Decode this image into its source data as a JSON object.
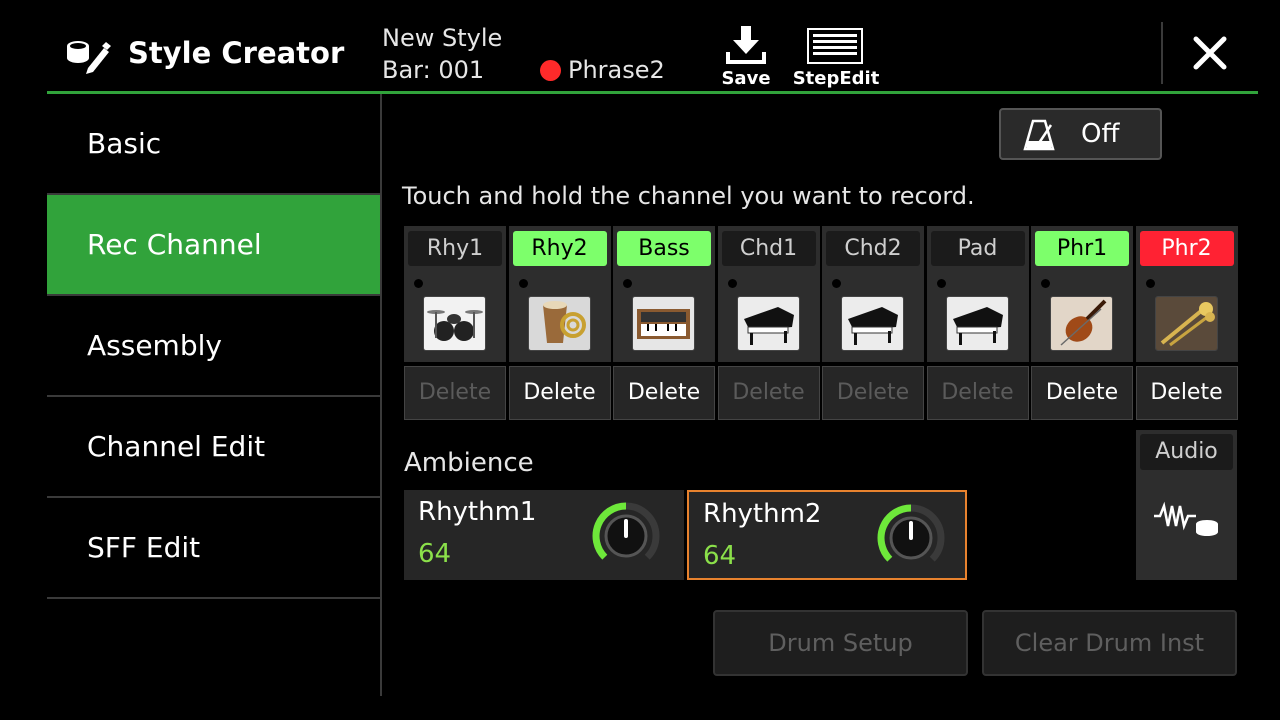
{
  "header": {
    "app_title": "Style Creator",
    "style_name": "New Style",
    "bar": "Bar: 001",
    "rec_target": "Phrase2",
    "save_label": "Save",
    "stepedit_label": "StepEdit"
  },
  "sidebar": {
    "items": [
      {
        "label": "Basic",
        "active": false
      },
      {
        "label": "Rec Channel",
        "active": true
      },
      {
        "label": "Assembly",
        "active": false
      },
      {
        "label": "Channel Edit",
        "active": false
      },
      {
        "label": "SFF Edit",
        "active": false
      }
    ]
  },
  "metronome": {
    "label": "Off"
  },
  "instruction": "Touch and hold the channel you want to record.",
  "channels": [
    {
      "label": "Rhy1",
      "state": "normal",
      "instrument": "drum-kit",
      "delete": "Delete",
      "delete_enabled": false
    },
    {
      "label": "Rhy2",
      "state": "on",
      "instrument": "percussion",
      "delete": "Delete",
      "delete_enabled": true
    },
    {
      "label": "Bass",
      "state": "on",
      "instrument": "synth-keyboard",
      "delete": "Delete",
      "delete_enabled": true
    },
    {
      "label": "Chd1",
      "state": "normal",
      "instrument": "grand-piano",
      "delete": "Delete",
      "delete_enabled": false
    },
    {
      "label": "Chd2",
      "state": "normal",
      "instrument": "grand-piano",
      "delete": "Delete",
      "delete_enabled": false
    },
    {
      "label": "Pad",
      "state": "normal",
      "instrument": "grand-piano",
      "delete": "Delete",
      "delete_enabled": false
    },
    {
      "label": "Phr1",
      "state": "on",
      "instrument": "violin",
      "delete": "Delete",
      "delete_enabled": true
    },
    {
      "label": "Phr2",
      "state": "rec",
      "instrument": "brass",
      "delete": "Delete",
      "delete_enabled": true
    }
  ],
  "ambience": {
    "label": "Ambience",
    "items": [
      {
        "name": "Rhythm1",
        "value": "64",
        "selected": false
      },
      {
        "name": "Rhythm2",
        "value": "64",
        "selected": true
      }
    ]
  },
  "audio": {
    "label": "Audio",
    "icon": "audio-wave-drum-icon"
  },
  "buttons": {
    "drum_setup": "Drum Setup",
    "clear_drum_inst": "Clear Drum Inst"
  },
  "colors": {
    "accent_green": "#31a33b",
    "channel_on": "#7dff6b",
    "channel_rec": "#ff2233",
    "selection": "#e8822e",
    "value_green": "#8be04a"
  }
}
